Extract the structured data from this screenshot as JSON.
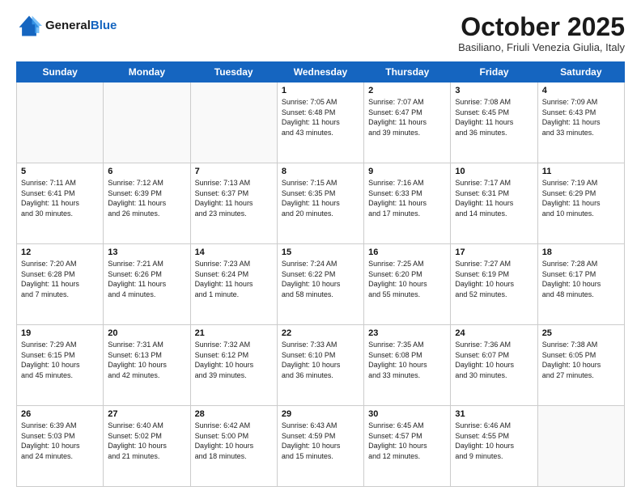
{
  "header": {
    "logo_line1": "General",
    "logo_line2": "Blue",
    "month_title": "October 2025",
    "location": "Basiliano, Friuli Venezia Giulia, Italy"
  },
  "days_of_week": [
    "Sunday",
    "Monday",
    "Tuesday",
    "Wednesday",
    "Thursday",
    "Friday",
    "Saturday"
  ],
  "weeks": [
    [
      {
        "day": "",
        "info": ""
      },
      {
        "day": "",
        "info": ""
      },
      {
        "day": "",
        "info": ""
      },
      {
        "day": "1",
        "info": "Sunrise: 7:05 AM\nSunset: 6:48 PM\nDaylight: 11 hours\nand 43 minutes."
      },
      {
        "day": "2",
        "info": "Sunrise: 7:07 AM\nSunset: 6:47 PM\nDaylight: 11 hours\nand 39 minutes."
      },
      {
        "day": "3",
        "info": "Sunrise: 7:08 AM\nSunset: 6:45 PM\nDaylight: 11 hours\nand 36 minutes."
      },
      {
        "day": "4",
        "info": "Sunrise: 7:09 AM\nSunset: 6:43 PM\nDaylight: 11 hours\nand 33 minutes."
      }
    ],
    [
      {
        "day": "5",
        "info": "Sunrise: 7:11 AM\nSunset: 6:41 PM\nDaylight: 11 hours\nand 30 minutes."
      },
      {
        "day": "6",
        "info": "Sunrise: 7:12 AM\nSunset: 6:39 PM\nDaylight: 11 hours\nand 26 minutes."
      },
      {
        "day": "7",
        "info": "Sunrise: 7:13 AM\nSunset: 6:37 PM\nDaylight: 11 hours\nand 23 minutes."
      },
      {
        "day": "8",
        "info": "Sunrise: 7:15 AM\nSunset: 6:35 PM\nDaylight: 11 hours\nand 20 minutes."
      },
      {
        "day": "9",
        "info": "Sunrise: 7:16 AM\nSunset: 6:33 PM\nDaylight: 11 hours\nand 17 minutes."
      },
      {
        "day": "10",
        "info": "Sunrise: 7:17 AM\nSunset: 6:31 PM\nDaylight: 11 hours\nand 14 minutes."
      },
      {
        "day": "11",
        "info": "Sunrise: 7:19 AM\nSunset: 6:29 PM\nDaylight: 11 hours\nand 10 minutes."
      }
    ],
    [
      {
        "day": "12",
        "info": "Sunrise: 7:20 AM\nSunset: 6:28 PM\nDaylight: 11 hours\nand 7 minutes."
      },
      {
        "day": "13",
        "info": "Sunrise: 7:21 AM\nSunset: 6:26 PM\nDaylight: 11 hours\nand 4 minutes."
      },
      {
        "day": "14",
        "info": "Sunrise: 7:23 AM\nSunset: 6:24 PM\nDaylight: 11 hours\nand 1 minute."
      },
      {
        "day": "15",
        "info": "Sunrise: 7:24 AM\nSunset: 6:22 PM\nDaylight: 10 hours\nand 58 minutes."
      },
      {
        "day": "16",
        "info": "Sunrise: 7:25 AM\nSunset: 6:20 PM\nDaylight: 10 hours\nand 55 minutes."
      },
      {
        "day": "17",
        "info": "Sunrise: 7:27 AM\nSunset: 6:19 PM\nDaylight: 10 hours\nand 52 minutes."
      },
      {
        "day": "18",
        "info": "Sunrise: 7:28 AM\nSunset: 6:17 PM\nDaylight: 10 hours\nand 48 minutes."
      }
    ],
    [
      {
        "day": "19",
        "info": "Sunrise: 7:29 AM\nSunset: 6:15 PM\nDaylight: 10 hours\nand 45 minutes."
      },
      {
        "day": "20",
        "info": "Sunrise: 7:31 AM\nSunset: 6:13 PM\nDaylight: 10 hours\nand 42 minutes."
      },
      {
        "day": "21",
        "info": "Sunrise: 7:32 AM\nSunset: 6:12 PM\nDaylight: 10 hours\nand 39 minutes."
      },
      {
        "day": "22",
        "info": "Sunrise: 7:33 AM\nSunset: 6:10 PM\nDaylight: 10 hours\nand 36 minutes."
      },
      {
        "day": "23",
        "info": "Sunrise: 7:35 AM\nSunset: 6:08 PM\nDaylight: 10 hours\nand 33 minutes."
      },
      {
        "day": "24",
        "info": "Sunrise: 7:36 AM\nSunset: 6:07 PM\nDaylight: 10 hours\nand 30 minutes."
      },
      {
        "day": "25",
        "info": "Sunrise: 7:38 AM\nSunset: 6:05 PM\nDaylight: 10 hours\nand 27 minutes."
      }
    ],
    [
      {
        "day": "26",
        "info": "Sunrise: 6:39 AM\nSunset: 5:03 PM\nDaylight: 10 hours\nand 24 minutes."
      },
      {
        "day": "27",
        "info": "Sunrise: 6:40 AM\nSunset: 5:02 PM\nDaylight: 10 hours\nand 21 minutes."
      },
      {
        "day": "28",
        "info": "Sunrise: 6:42 AM\nSunset: 5:00 PM\nDaylight: 10 hours\nand 18 minutes."
      },
      {
        "day": "29",
        "info": "Sunrise: 6:43 AM\nSunset: 4:59 PM\nDaylight: 10 hours\nand 15 minutes."
      },
      {
        "day": "30",
        "info": "Sunrise: 6:45 AM\nSunset: 4:57 PM\nDaylight: 10 hours\nand 12 minutes."
      },
      {
        "day": "31",
        "info": "Sunrise: 6:46 AM\nSunset: 4:55 PM\nDaylight: 10 hours\nand 9 minutes."
      },
      {
        "day": "",
        "info": ""
      }
    ]
  ]
}
